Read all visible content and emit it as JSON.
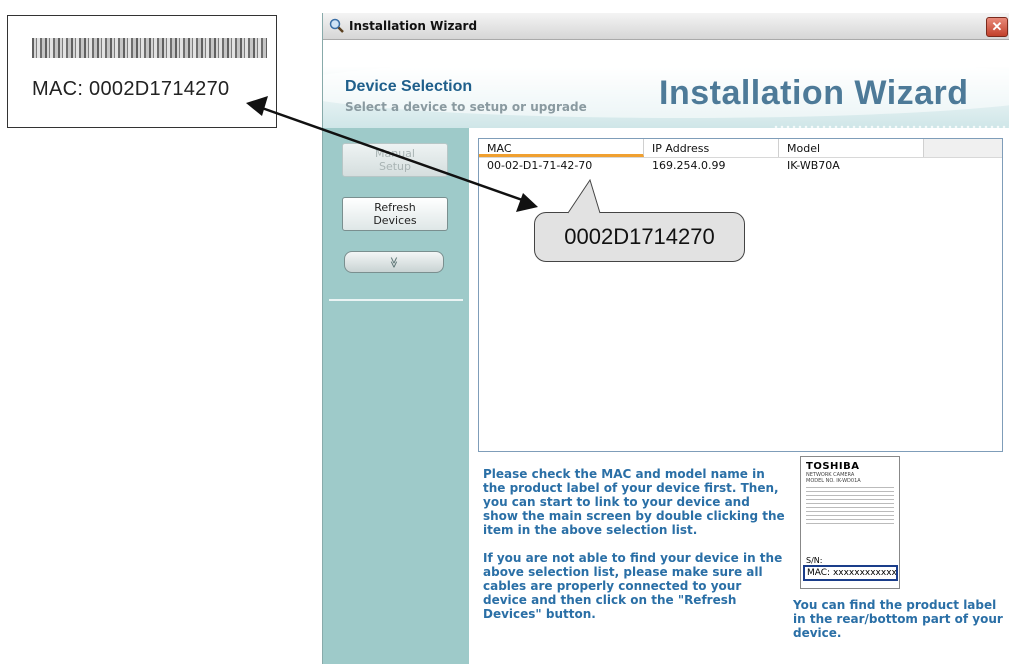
{
  "callout_label": {
    "mac_text": "MAC: 0002D1714270"
  },
  "callout_bubble": {
    "text": "0002D1714270"
  },
  "window": {
    "title": "Installation Wizard",
    "close_glyph": "✕"
  },
  "banner": {
    "heading": "Device Selection",
    "subheading": "Select a device to setup or upgrade",
    "brand_title": "Installation Wizard"
  },
  "sidebar": {
    "manual_setup": [
      "Manual",
      "Setup"
    ],
    "refresh_devices": [
      "Refresh",
      "Devices"
    ],
    "expand_glyph": "≫"
  },
  "device_list": {
    "columns": [
      "MAC",
      "IP Address",
      "Model"
    ],
    "rows": [
      {
        "mac": "00-02-D1-71-42-70",
        "ip": "169.254.0.99",
        "model": "IK-WB70A"
      }
    ]
  },
  "instructions": {
    "paragraph1": "Please check the MAC and model name in the product label of your device first. Then, you can start to link to your device and show the main screen by double clicking the item in the above selection list.",
    "paragraph2": "If you are not able to find your device in the above selection list, please make sure all cables are properly connected to your device and then click on the \"Refresh Devices\" button."
  },
  "product_label": {
    "brand": "TOSHIBA",
    "line1": "NETWORK CAMERA",
    "line2": "MODEL NO. IK-WD01A",
    "sn": "S/N:",
    "mac": "MAC: xxxxxxxxxxxx",
    "caption": "You can find the product label in the rear/bottom part of your device."
  }
}
